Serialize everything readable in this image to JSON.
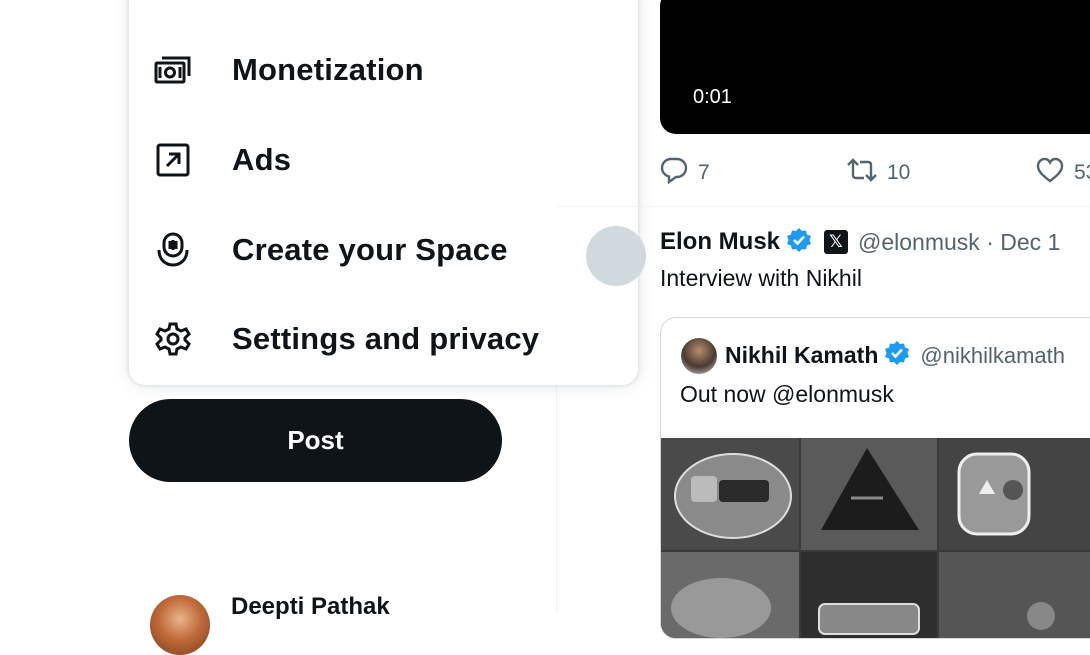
{
  "menu": {
    "items": [
      {
        "label": "Monetization",
        "icon": "money-icon"
      },
      {
        "label": "Ads",
        "icon": "arrow-box-icon"
      },
      {
        "label": "Create your Space",
        "icon": "microphone-icon"
      },
      {
        "label": "Settings and privacy",
        "icon": "gear-icon"
      }
    ]
  },
  "post_button": {
    "label": "Post"
  },
  "account": {
    "name": "Deepti Pathak"
  },
  "video": {
    "duration": "0:01"
  },
  "actions": {
    "replies": "7",
    "reposts": "10",
    "likes": "53"
  },
  "tweet": {
    "author": "Elon Musk",
    "handle": "@elonmusk · Dec 1",
    "text": "Interview with Nikhil",
    "quote": {
      "author": "Nikhil Kamath",
      "handle": "@nikhilkamath",
      "text": "Out now @elonmusk"
    }
  },
  "colors": {
    "verified": "#1d9bf0",
    "text_secondary": "#536471",
    "post_button": "#0f1419"
  }
}
